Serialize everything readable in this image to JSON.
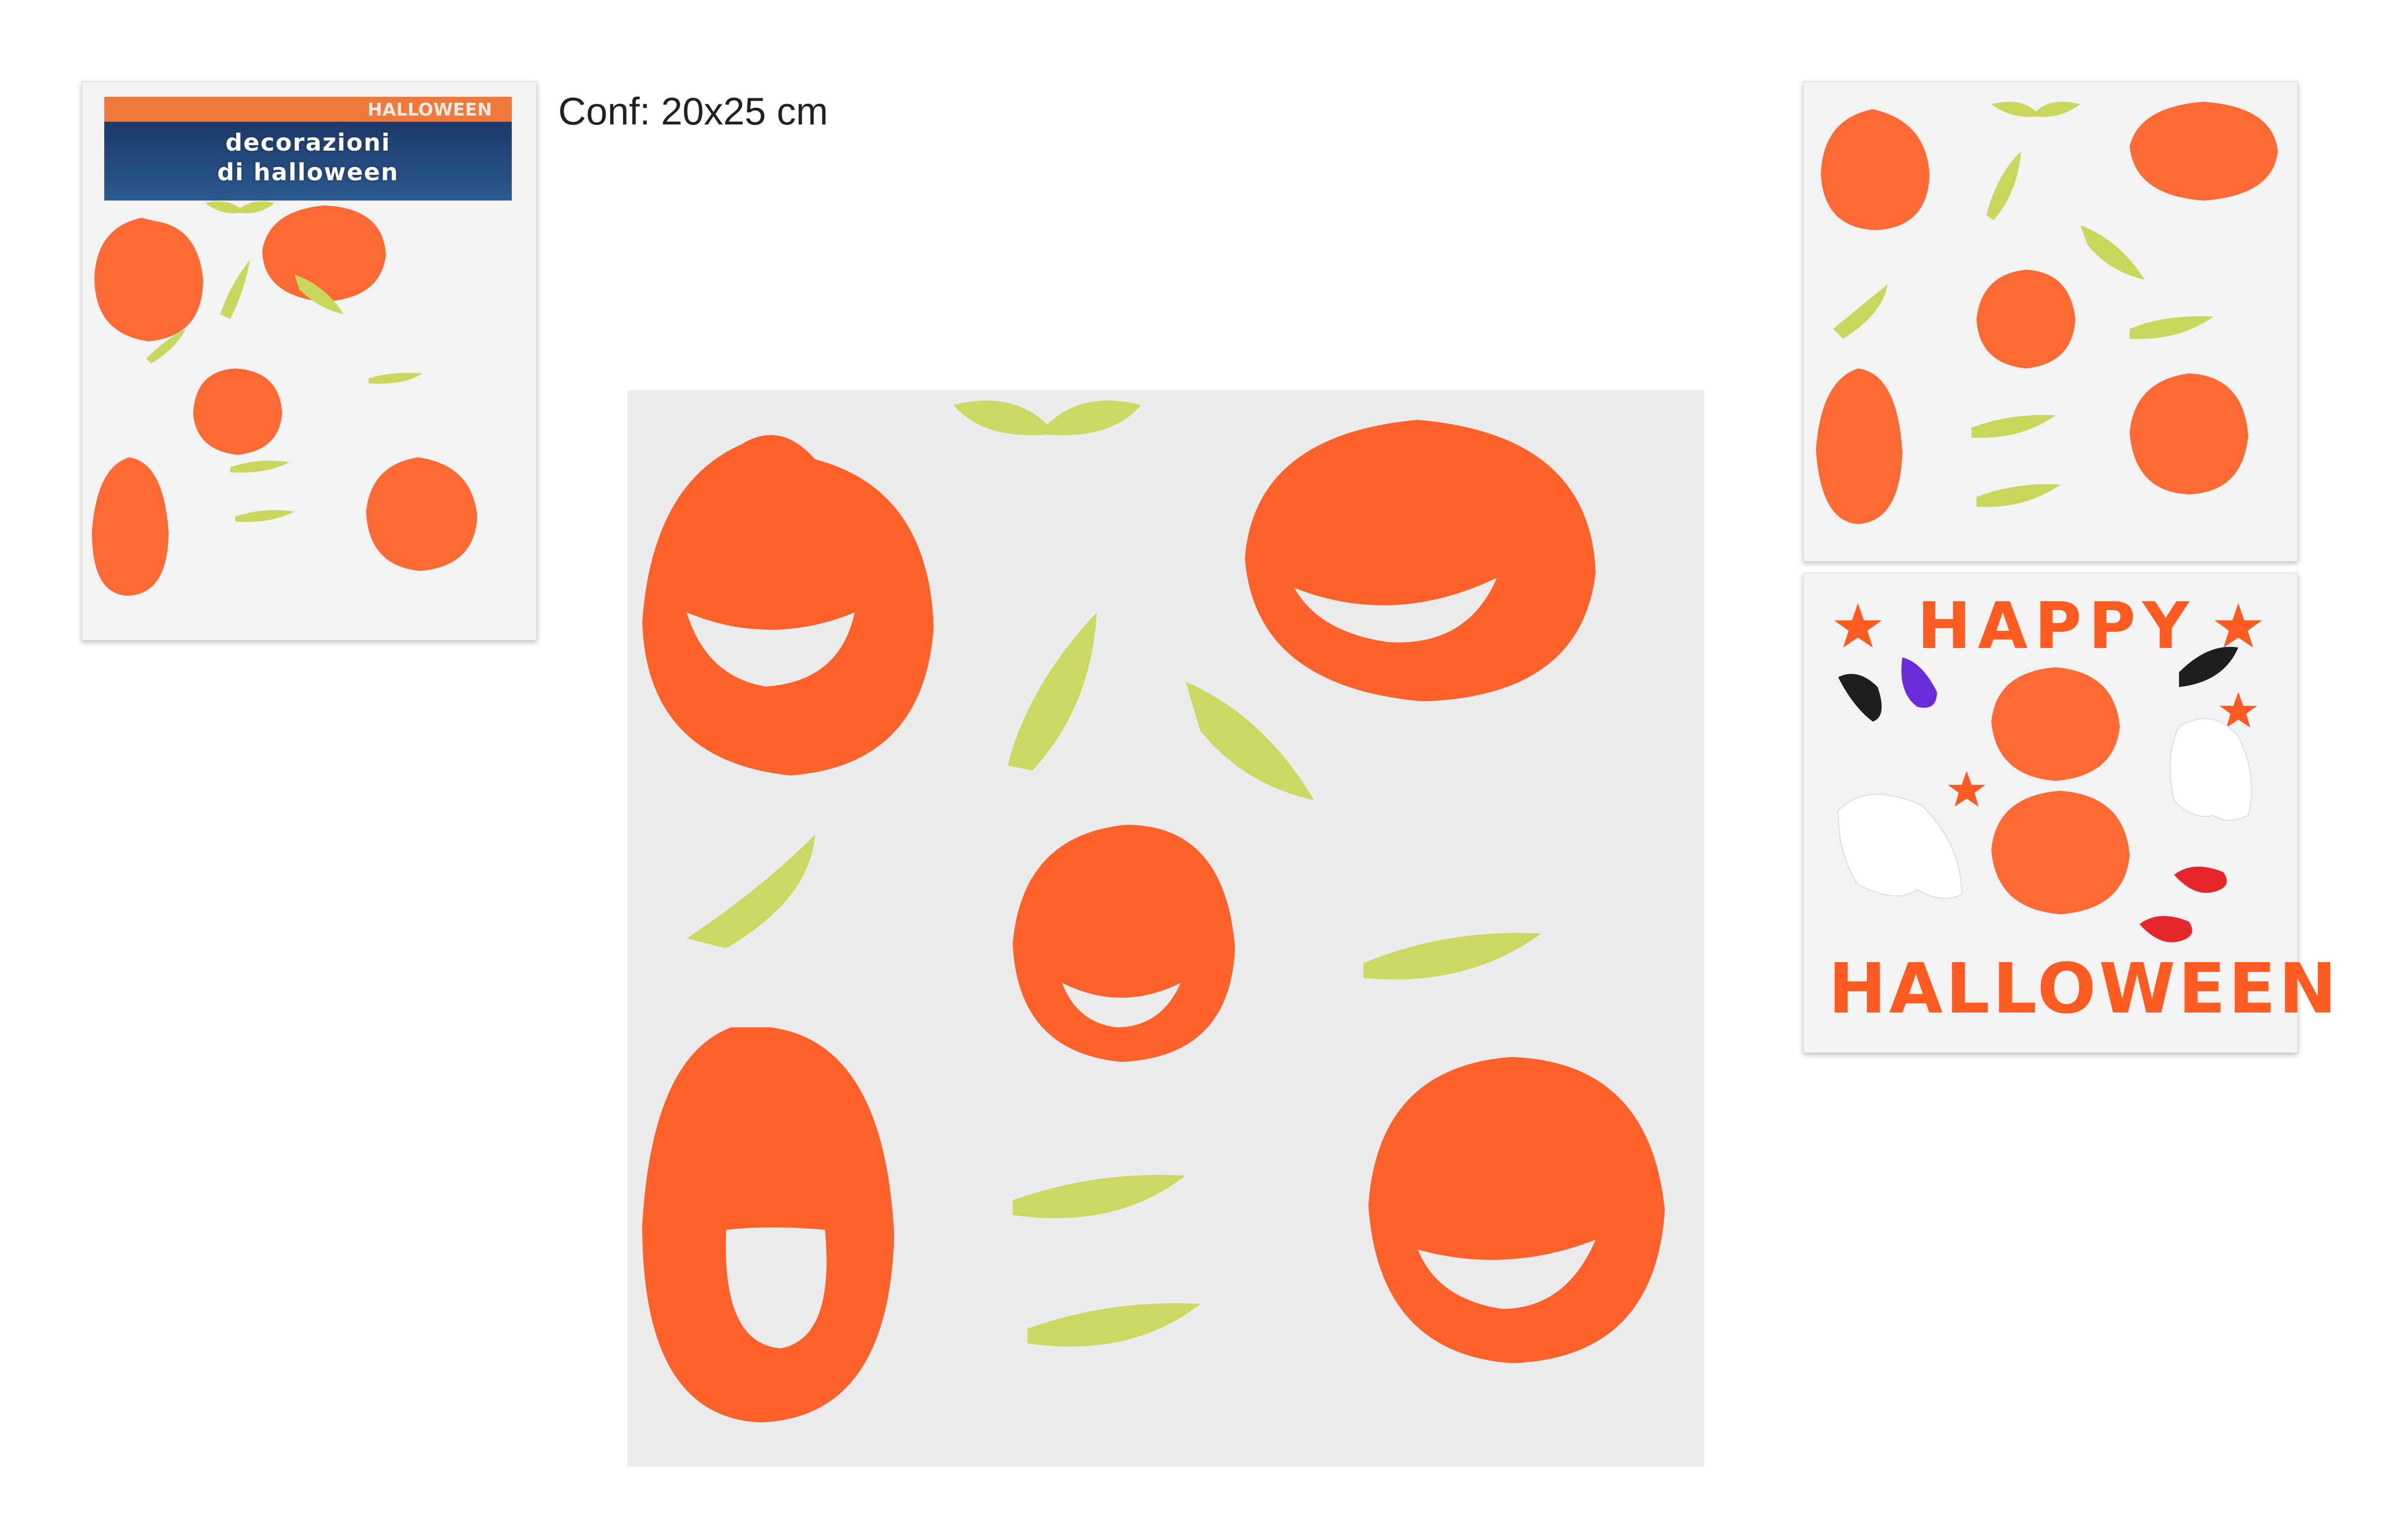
{
  "size_label": "Conf: 20x25 cm",
  "package": {
    "tag": "HALLOWEEN",
    "title_line1": "decorazioni",
    "title_line2": "di halloween"
  },
  "variant_happy": {
    "word1": "HAPPY",
    "word2": "HALLOWEEN"
  },
  "colors": {
    "pumpkin": "#ff5a1f",
    "bat": "#c9d85c",
    "sheet": "#ececec",
    "black_letter": "#1e1e1e",
    "ghost": "#ffffff",
    "candy_purple": "#6a2bd8",
    "candy_red": "#e5262a"
  }
}
